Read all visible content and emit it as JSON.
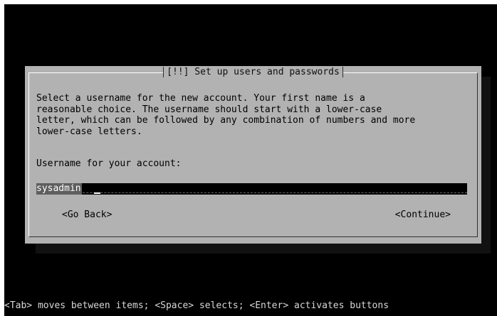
{
  "dialog": {
    "title": "[!!] Set up users and passwords",
    "description": "Select a username for the new account. Your first name is a\nreasonable choice. The username should start with a lower-case\nletter, which can be followed by any combination of numbers and more\nlower-case letters.",
    "field_label": "Username for your account:",
    "username_value": "sysadmin",
    "buttons": {
      "back": "<Go Back>",
      "continue": "<Continue>"
    }
  },
  "status_bar": {
    "hint": "<Tab> moves between items; <Space> selects; <Enter> activates buttons"
  },
  "colors": {
    "screen_bg": "#000000",
    "dialog_bg": "#b2b2b2",
    "input_bg": "#000000",
    "selection_bg": "#5e5e5e"
  }
}
